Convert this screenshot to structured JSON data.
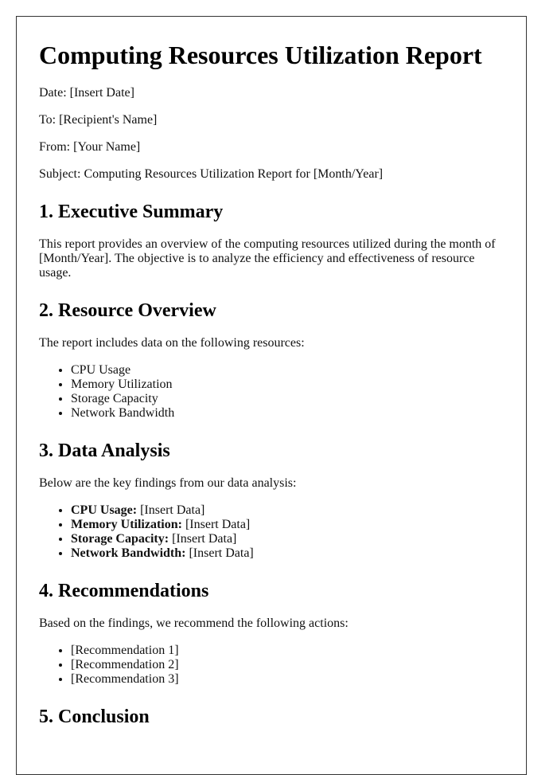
{
  "title": "Computing Resources Utilization Report",
  "meta": {
    "date": "Date: [Insert Date]",
    "to": "To: [Recipient's Name]",
    "from": "From: [Your Name]",
    "subject": "Subject: Computing Resources Utilization Report for [Month/Year]"
  },
  "sections": {
    "executive_summary": {
      "heading": "1. Executive Summary",
      "body": "This report provides an overview of the computing resources utilized during the month of [Month/Year]. The objective is to analyze the efficiency and effectiveness of resource usage."
    },
    "resource_overview": {
      "heading": "2. Resource Overview",
      "intro": "The report includes data on the following resources:",
      "items": [
        "CPU Usage",
        "Memory Utilization",
        "Storage Capacity",
        "Network Bandwidth"
      ]
    },
    "data_analysis": {
      "heading": "3. Data Analysis",
      "intro": "Below are the key findings from our data analysis:",
      "items": [
        {
          "label": "CPU Usage:",
          "value": " [Insert Data]"
        },
        {
          "label": "Memory Utilization:",
          "value": " [Insert Data]"
        },
        {
          "label": "Storage Capacity:",
          "value": " [Insert Data]"
        },
        {
          "label": "Network Bandwidth:",
          "value": " [Insert Data]"
        }
      ]
    },
    "recommendations": {
      "heading": "4. Recommendations",
      "intro": "Based on the findings, we recommend the following actions:",
      "items": [
        "[Recommendation 1]",
        "[Recommendation 2]",
        "[Recommendation 3]"
      ]
    },
    "conclusion": {
      "heading": "5. Conclusion"
    }
  }
}
